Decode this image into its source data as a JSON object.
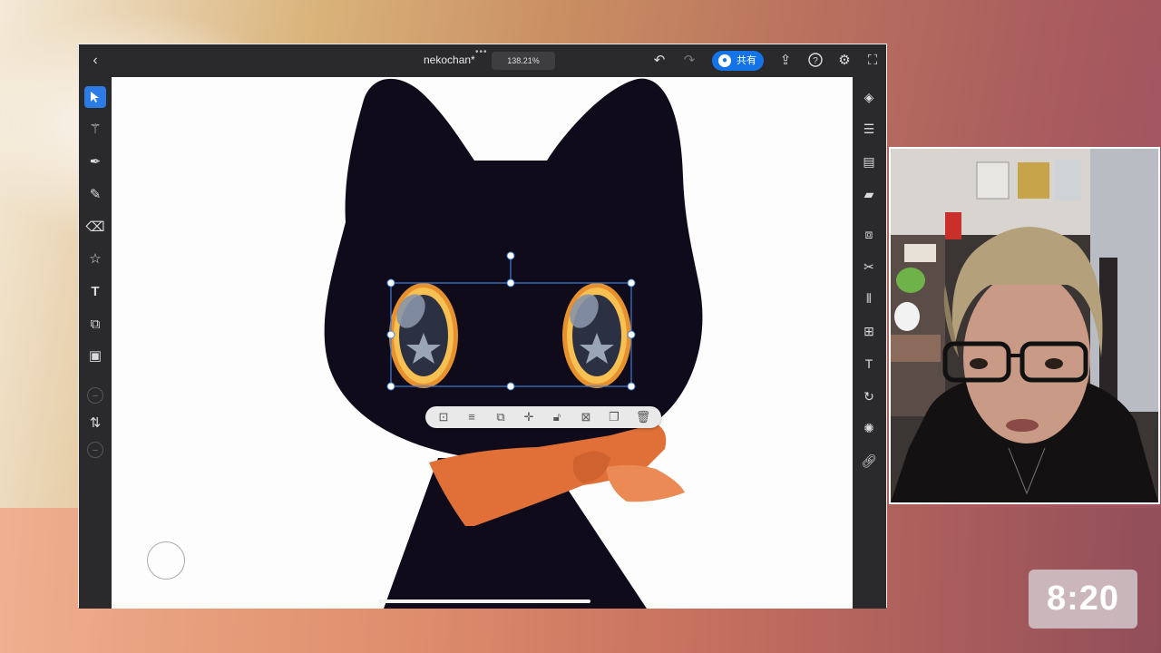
{
  "app": {
    "document_title": "nekochan*",
    "zoom_level": "138.21%",
    "share_label": "共有"
  },
  "topbar_icons": [
    "back-icon",
    "undo-icon",
    "redo-icon",
    "export-icon",
    "help-icon",
    "settings-icon",
    "fullscreen-icon"
  ],
  "left_tools": [
    "select-icon",
    "magic-select-icon",
    "pen-icon",
    "pencil-icon",
    "eraser-icon",
    "shape-star-icon",
    "text-icon",
    "crop-icon",
    "image-icon",
    "swap-color-icon"
  ],
  "right_tools": [
    "layers-icon",
    "properties-icon",
    "rulers-icon",
    "comments-icon",
    "combine-shapes-icon",
    "cut-icon",
    "align-icon",
    "transform-icon",
    "type-icon",
    "path-icon",
    "repeat-icon",
    "link-icon"
  ],
  "selection_toolbar": [
    "group-icon",
    "align-menu-icon",
    "arrange-icon",
    "move-icon",
    "lock-icon",
    "mask-icon",
    "duplicate-icon",
    "delete-icon"
  ],
  "colors": {
    "accent": "#2d7be5",
    "share": "#1473e6",
    "cat_body": "#0f0b1a",
    "scarf": "#e07038",
    "eye_ring": "#f3a83a"
  },
  "timer": "8:20"
}
